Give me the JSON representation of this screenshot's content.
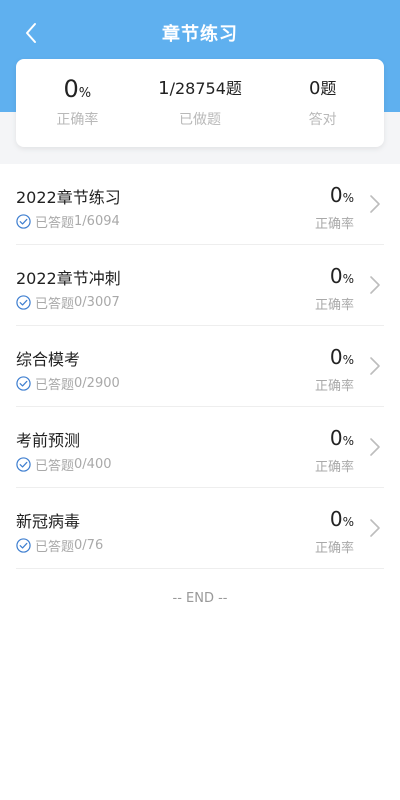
{
  "header": {
    "title": "章节练习"
  },
  "stats": {
    "accuracy": {
      "value": "0",
      "unit": "%",
      "label": "正确率"
    },
    "done": {
      "done": "1",
      "total": "/28754",
      "unit": "题",
      "label": "已做题"
    },
    "correct": {
      "value": "0",
      "unit": "题",
      "label": "答对"
    }
  },
  "items": [
    {
      "title": "2022章节练习",
      "answered_prefix": "已答题",
      "answered": "1/6094",
      "rate": "0",
      "rate_unit": "%",
      "rate_label": "正确率"
    },
    {
      "title": "2022章节冲刺",
      "answered_prefix": "已答题",
      "answered": "0/3007",
      "rate": "0",
      "rate_unit": "%",
      "rate_label": "正确率"
    },
    {
      "title": "综合模考",
      "answered_prefix": "已答题",
      "answered": "0/2900",
      "rate": "0",
      "rate_unit": "%",
      "rate_label": "正确率"
    },
    {
      "title": "考前预测",
      "answered_prefix": "已答题",
      "answered": "0/400",
      "rate": "0",
      "rate_unit": "%",
      "rate_label": "正确率"
    },
    {
      "title": "新冠病毒",
      "answered_prefix": "已答题",
      "answered": "0/76",
      "rate": "0",
      "rate_unit": "%",
      "rate_label": "正确率"
    }
  ],
  "footer": {
    "end_text": "-- END --"
  },
  "colors": {
    "primary": "#5fb0ef",
    "check": "#3f7fd0",
    "muted": "#a9a9a9"
  }
}
